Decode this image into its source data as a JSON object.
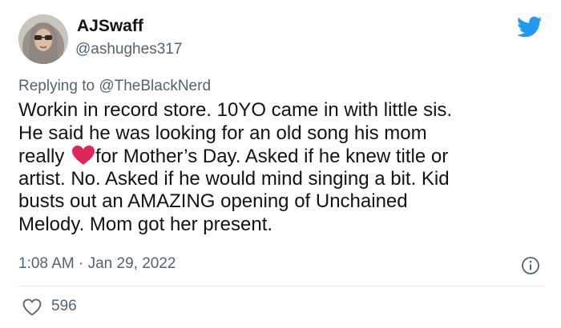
{
  "user": {
    "display_name": "AJSwaff",
    "handle": "@ashughes317",
    "avatar_icon": "profile-photo"
  },
  "brand": {
    "icon": "twitter-bird-icon",
    "color": "#1d9bf0"
  },
  "reply": {
    "prefix": "Replying to ",
    "mention": "@TheBlackNerd"
  },
  "tweet": {
    "lines": [
      "Workin in record store. 10YO came in with little sis.",
      "He said he was looking for an old song his mom",
      "artist. No. Asked if he would mind singing a bit. Kid",
      "busts out an AMAZING opening of Unchained",
      "Melody. Mom got her present."
    ],
    "line3_before": "really ",
    "line3_after": "for Mother’s Day. Asked if he knew title or",
    "emoji": "red-heart",
    "emoji_color": "#e0245e"
  },
  "meta": {
    "time": "1:08 AM",
    "separator": " · ",
    "date": "Jan 29, 2022"
  },
  "engagement": {
    "likes": "596",
    "like_icon": "heart-outline-icon",
    "info_icon": "info-icon"
  }
}
